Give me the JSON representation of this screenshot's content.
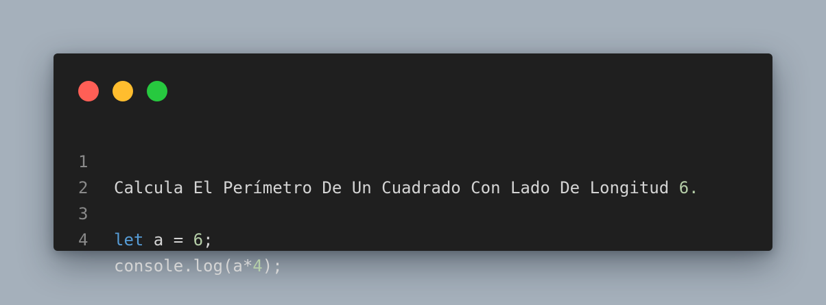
{
  "colors": {
    "background": "#a5b0bb",
    "window": "#1f1f1f",
    "dot_close": "#ff5f56",
    "dot_minimize": "#ffbd2e",
    "dot_maximize": "#27c93f",
    "text": "#d4d4d4",
    "line_number": "#8a8a8a",
    "keyword": "#569cd6",
    "number": "#b5cea8"
  },
  "window_controls": [
    "close",
    "minimize",
    "maximize"
  ],
  "code_lines": [
    {
      "number": "1",
      "tokens": [
        {
          "text": "Calcula El Perímetro De Un Cuadrado Con Lado De Longitud ",
          "type": "text"
        },
        {
          "text": "6.",
          "type": "number"
        }
      ]
    },
    {
      "number": "2",
      "tokens": []
    },
    {
      "number": "3",
      "tokens": [
        {
          "text": "let",
          "type": "keyword"
        },
        {
          "text": " a = ",
          "type": "text"
        },
        {
          "text": "6",
          "type": "number"
        },
        {
          "text": ";",
          "type": "text"
        }
      ]
    },
    {
      "number": "4",
      "tokens": [
        {
          "text": "console.log(a*",
          "type": "text"
        },
        {
          "text": "4",
          "type": "number"
        },
        {
          "text": ");",
          "type": "text"
        }
      ]
    }
  ]
}
